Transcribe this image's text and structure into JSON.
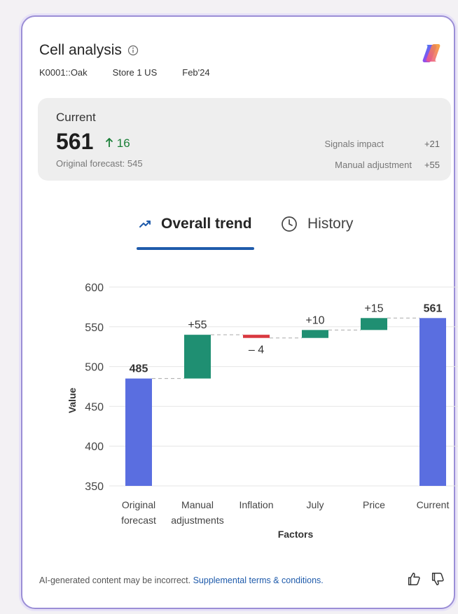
{
  "header": {
    "title": "Cell analysis",
    "item": "K0001::Oak",
    "store": "Store 1 US",
    "period": "Feb'24"
  },
  "current": {
    "label": "Current",
    "value": "561",
    "delta": "16",
    "original_forecast": "Original forecast: 545",
    "signals_label": "Signals impact",
    "signals_value": "+21",
    "manual_label": "Manual adjustment",
    "manual_value": "+55"
  },
  "tabs": [
    {
      "label": "Overall trend",
      "icon": "trend-icon",
      "selected": true
    },
    {
      "label": "History",
      "icon": "clock-icon",
      "selected": false
    }
  ],
  "colors": {
    "total": "#5a6ee0",
    "increase": "#1f8f72",
    "decrease": "#d9383f",
    "accent": "#1f5bab"
  },
  "chart_data": {
    "type": "waterfall",
    "xlabel": "Factors",
    "ylabel": "Value",
    "ylim": [
      350,
      600
    ],
    "yticks": [
      350,
      400,
      450,
      500,
      550,
      600
    ],
    "categories": [
      [
        "Original",
        "forecast"
      ],
      [
        "Manual",
        "adjustments"
      ],
      [
        "Inflation"
      ],
      [
        "July"
      ],
      [
        "Price"
      ],
      [
        "Current"
      ]
    ],
    "steps": [
      {
        "kind": "total",
        "start": 350,
        "end": 485,
        "label": "485"
      },
      {
        "kind": "increase",
        "start": 485,
        "end": 540,
        "label": "+55"
      },
      {
        "kind": "decrease",
        "start": 540,
        "end": 536,
        "label": "– 4"
      },
      {
        "kind": "increase",
        "start": 536,
        "end": 546,
        "label": "+10"
      },
      {
        "kind": "increase",
        "start": 546,
        "end": 561,
        "label": "+15"
      },
      {
        "kind": "total",
        "start": 350,
        "end": 561,
        "label": "561"
      }
    ]
  },
  "footer": {
    "disclaimer": "AI-generated content may be incorrect.",
    "link": "Supplemental terms & conditions."
  }
}
